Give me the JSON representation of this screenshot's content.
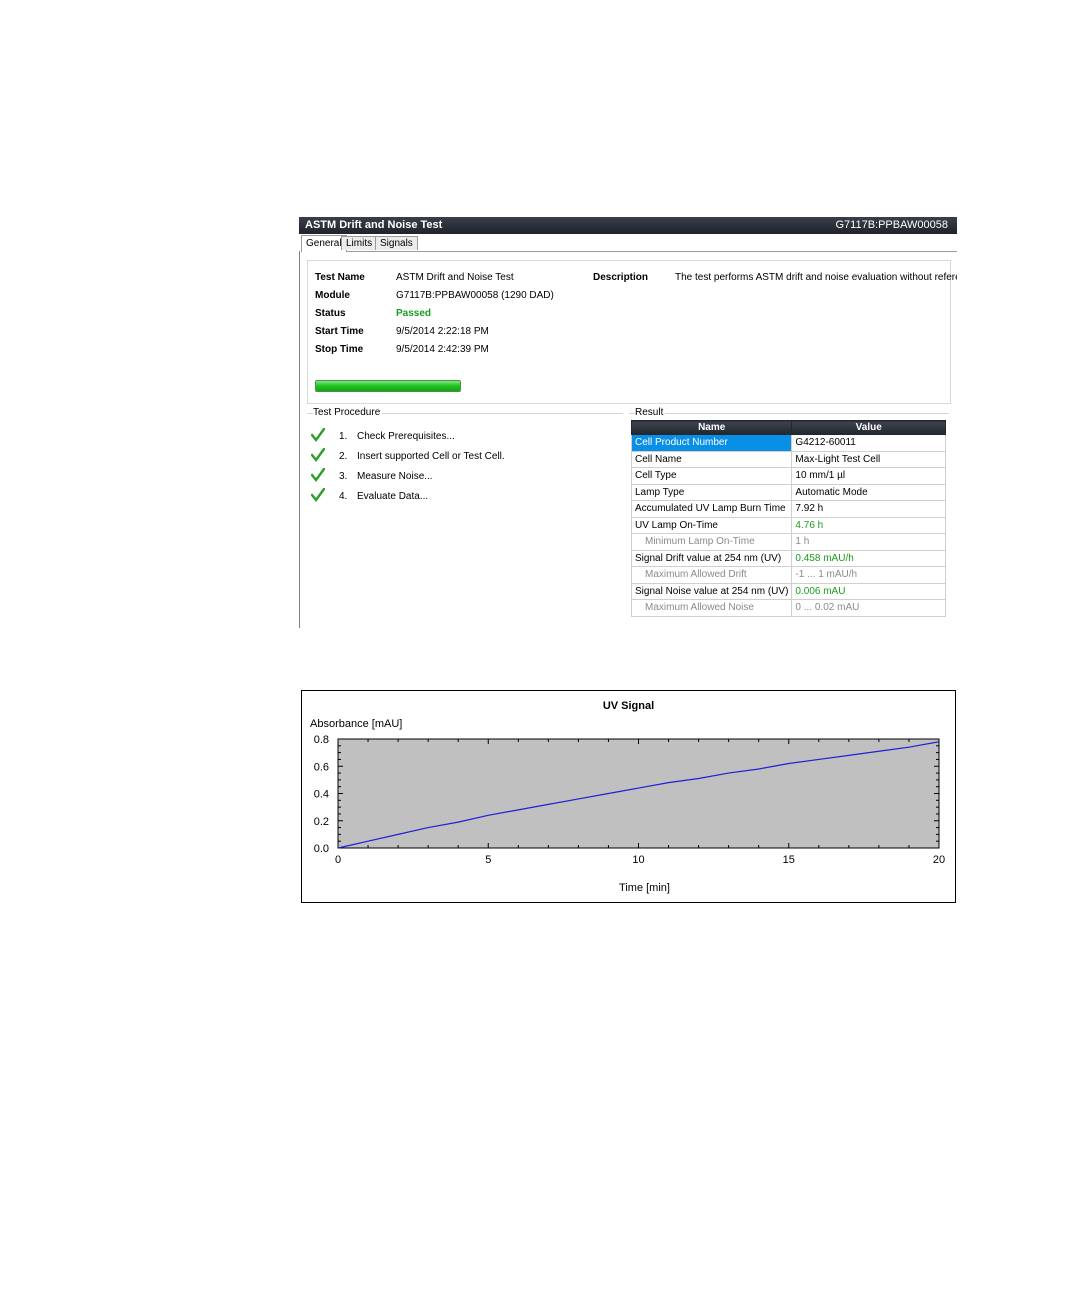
{
  "window": {
    "title": "ASTM Drift and Noise Test",
    "module_id": "G7117B:PPBAW00058",
    "tabs": [
      {
        "label": "General",
        "active": true
      },
      {
        "label": "Limits",
        "active": false
      },
      {
        "label": "Signals",
        "active": false
      }
    ]
  },
  "general": {
    "labels": {
      "test_name": "Test Name",
      "module": "Module",
      "status": "Status",
      "start_time": "Start Time",
      "stop_time": "Stop Time",
      "description": "Description"
    },
    "values": {
      "test_name": "ASTM Drift and Noise Test",
      "module": "G7117B:PPBAW00058 (1290 DAD)",
      "status": "Passed",
      "start_time": "9/5/2014 2:22:18 PM",
      "stop_time": "9/5/2014 2:42:39 PM",
      "description": "The test performs ASTM drift and noise evaluation without reference."
    },
    "progress_fraction": 1.0,
    "status_color": "#1a9c1a"
  },
  "procedure": {
    "title": "Test Procedure",
    "steps": [
      {
        "num": "1.",
        "label": "Check Prerequisites..."
      },
      {
        "num": "2.",
        "label": "Insert supported Cell or Test Cell."
      },
      {
        "num": "3.",
        "label": "Measure Noise..."
      },
      {
        "num": "4.",
        "label": "Evaluate Data..."
      }
    ]
  },
  "result": {
    "title": "Result",
    "headers": {
      "name": "Name",
      "value": "Value"
    },
    "rows": [
      {
        "name": "Cell Product Number",
        "value": "G4212-60011"
      },
      {
        "name": "Cell Name",
        "value": "Max-Light Test Cell"
      },
      {
        "name": "Cell Type",
        "value": "10 mm/1 µl"
      },
      {
        "name": "Lamp Type",
        "value": "Automatic Mode"
      },
      {
        "name": "Accumulated UV Lamp Burn Time",
        "value": "7.92 h"
      },
      {
        "name": "UV Lamp On-Time",
        "value": "4.76 h"
      },
      {
        "name": "Minimum Lamp On-Time",
        "value": "1 h"
      },
      {
        "name": "Signal Drift value at 254 nm (UV)",
        "value": "0.458 mAU/h"
      },
      {
        "name": "Maximum Allowed Drift",
        "value": "-1 ... 1 mAU/h"
      },
      {
        "name": "Signal Noise value at 254 nm (UV)",
        "value": "0.006 mAU"
      },
      {
        "name": "Maximum Allowed Noise",
        "value": "0 ... 0.02 mAU"
      }
    ]
  },
  "chart_data": {
    "type": "line",
    "title": "UV Signal",
    "xlabel": "Time [min]",
    "ylabel": "Absorbance [mAU]",
    "xlim": [
      0,
      20
    ],
    "ylim": [
      0,
      0.8
    ],
    "x_ticks": [
      "0",
      "5",
      "10",
      "15",
      "20"
    ],
    "y_ticks": [
      "0.0",
      "0.2",
      "0.4",
      "0.6",
      "0.8"
    ],
    "grid": false,
    "plot_background": "#c0c0c0",
    "series": [
      {
        "color": "#1f1fd6",
        "x": [
          0,
          1,
          2,
          3,
          4,
          5,
          6,
          7,
          8,
          9,
          10,
          11,
          12,
          13,
          14,
          15,
          16,
          17,
          18,
          19,
          20
        ],
        "y": [
          0.0,
          0.05,
          0.1,
          0.15,
          0.19,
          0.24,
          0.28,
          0.32,
          0.36,
          0.4,
          0.44,
          0.48,
          0.51,
          0.55,
          0.58,
          0.62,
          0.65,
          0.68,
          0.71,
          0.74,
          0.78
        ]
      }
    ]
  }
}
